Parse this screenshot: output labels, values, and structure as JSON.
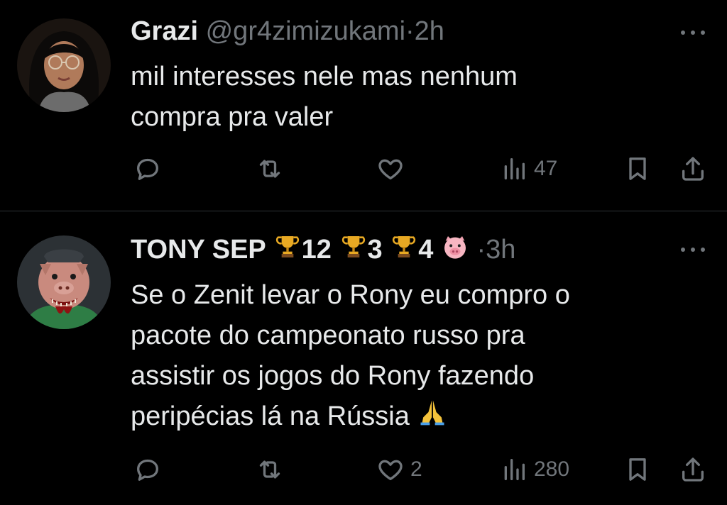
{
  "tweets": [
    {
      "name": "Grazi",
      "handle": "@gr4zimizukami",
      "sep": "·",
      "time": "2h",
      "text_lines": [
        "mil interesses nele mas nenhum",
        "compra pra valer"
      ],
      "stats": {
        "likes": "",
        "views": "47"
      }
    },
    {
      "name": "TONY SEP",
      "badges": [
        "12",
        "3",
        "4"
      ],
      "sep": "·",
      "time": "3h",
      "text_lines": [
        "Se o Zenit levar o Rony eu compro o",
        "pacote do campeonato russo pra",
        "assistir os jogos do Rony fazendo",
        "peripécias lá na Rússia"
      ],
      "stats": {
        "likes": "2",
        "views": "280"
      }
    }
  ],
  "icons": [
    "more-icon",
    "reply-icon",
    "retweet-icon",
    "like-icon",
    "views-icon",
    "bookmark-icon",
    "share-icon",
    "trophy-icon",
    "pig-face-icon",
    "folded-hands-icon"
  ],
  "colors": {
    "background": "#000000",
    "text": "#e7e9ea",
    "muted": "#71767b",
    "divider": "#2f3336",
    "trophy": "#e8a923"
  }
}
